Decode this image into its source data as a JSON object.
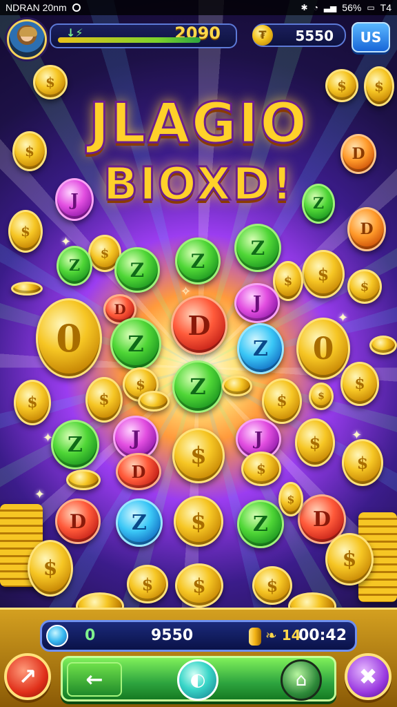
{
  "status_bar": {
    "left_text": "NDRAN 20nm",
    "right_text": "56%",
    "carrier_right": "T4"
  },
  "hud": {
    "xp_label": "↓⚡",
    "xp_value": "2090",
    "xp_progress": 0.82,
    "coins_value": "5550",
    "coin_symbol": "₮",
    "menu_label": "US"
  },
  "title": {
    "line1": "JLAGIO",
    "line2": "BIOXD!"
  },
  "coin_glyphs": {
    "gold": "$",
    "green": "Z",
    "purple": "J",
    "red": "D",
    "blue": "Z",
    "orange": "D",
    "zero": "0"
  },
  "bottom_bar": {
    "left_value": "0",
    "score": "9550",
    "rate": "❧ 14",
    "timer": "00:42"
  },
  "buttons": {
    "back_icon": "back-arrow-icon",
    "center_icon": "orb-icon",
    "home_icon": "home-icon",
    "left_icon": "megaphone-icon",
    "right_icon": "tools-icon",
    "back_glyph": "←",
    "center_glyph": "◐",
    "home_glyph": "⌂",
    "left_glyph": "↗",
    "right_glyph": "✖"
  },
  "colors": {
    "title_gold": "#ffd12a",
    "accent_blue": "#5ab8ff",
    "accent_green": "#2ea53f"
  }
}
